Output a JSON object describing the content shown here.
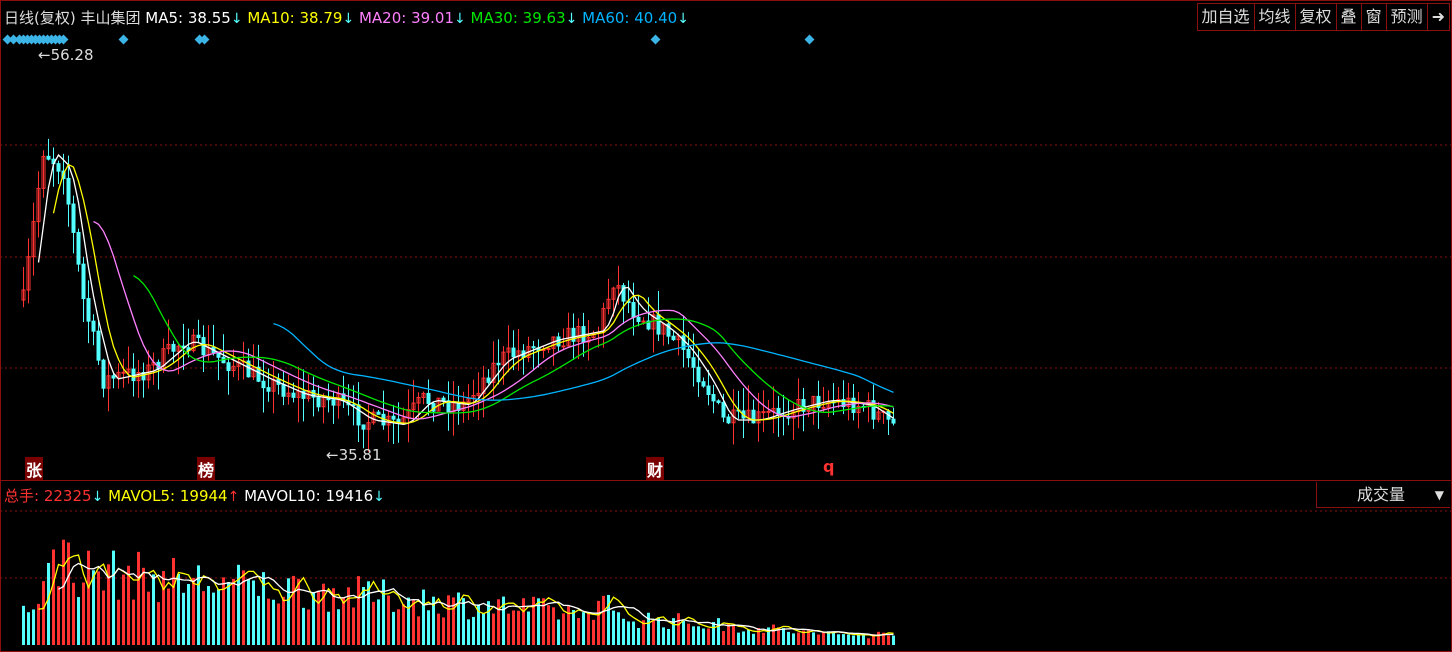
{
  "legend": {
    "period": "日线(复权)",
    "stock": "丰山集团",
    "ma5_label": "MA5:",
    "ma5_value": "38.55",
    "ma10_label": "MA10:",
    "ma10_value": "38.79",
    "ma20_label": "MA20:",
    "ma20_value": "39.01",
    "ma30_label": "MA30:",
    "ma30_value": "39.63",
    "ma60_label": "MA60:",
    "ma60_value": "40.40",
    "down_arrow": "↓",
    "up_arrow": "↑"
  },
  "toolbar": {
    "buttons": [
      "加自选",
      "均线",
      "复权",
      "叠",
      "窗",
      "预测",
      "➜"
    ]
  },
  "price_annotations": {
    "high": "←56.28",
    "low": "←35.81"
  },
  "events": [
    "张",
    "榜",
    "财",
    "q"
  ],
  "volume_legend": {
    "total_label": "总手:",
    "total_value": "22325",
    "mavol5_label": "MAVOL5:",
    "mavol5_value": "19944",
    "mavol10_label": "MAVOL10:",
    "mavol10_value": "19416"
  },
  "volume_selector": "成交量",
  "colors": {
    "up": "#ff3232",
    "down": "#54ffff",
    "ma5": "#ffffff",
    "ma10": "#ffff00",
    "ma20": "#ff80ff",
    "ma30": "#00e600",
    "ma60": "#00b4ff",
    "grid": "#8a1010"
  }
}
